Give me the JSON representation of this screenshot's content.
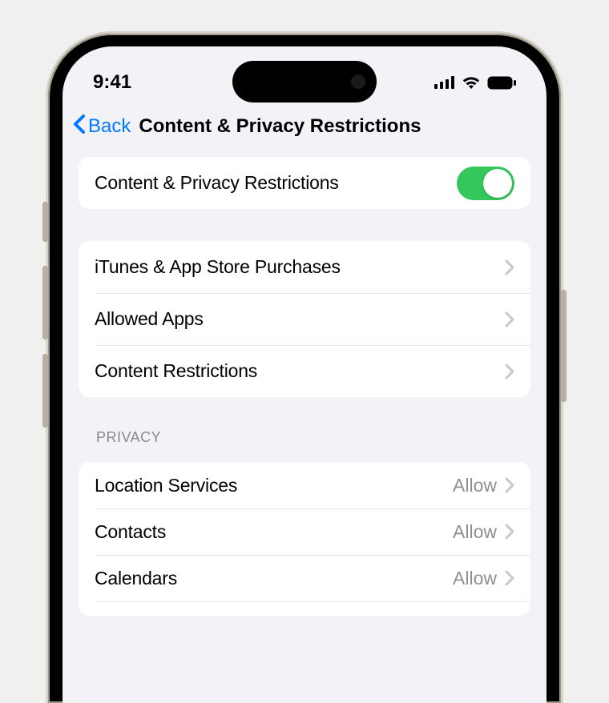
{
  "status": {
    "time": "9:41"
  },
  "nav": {
    "back_label": "Back",
    "title": "Content & Privacy Restrictions"
  },
  "toggle_row": {
    "label": "Content & Privacy Restrictions",
    "enabled": true
  },
  "main_rows": [
    {
      "label": "iTunes & App Store Purchases"
    },
    {
      "label": "Allowed Apps"
    },
    {
      "label": "Content Restrictions"
    }
  ],
  "privacy_header": "PRIVACY",
  "privacy_rows": [
    {
      "label": "Location Services",
      "value": "Allow"
    },
    {
      "label": "Contacts",
      "value": "Allow"
    },
    {
      "label": "Calendars",
      "value": "Allow"
    }
  ]
}
